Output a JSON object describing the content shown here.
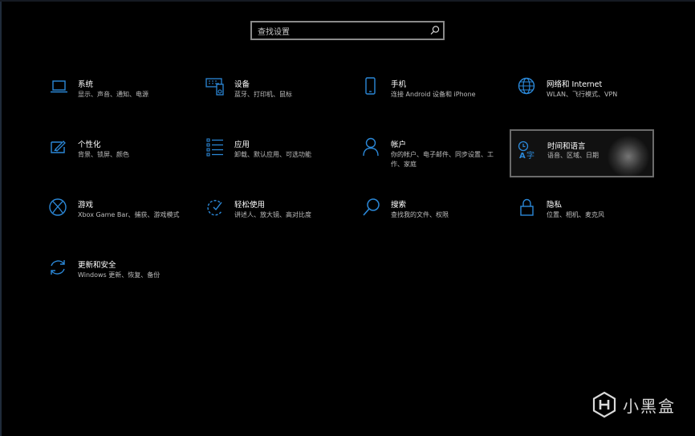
{
  "search": {
    "placeholder": "查找设置",
    "icon": "search-icon"
  },
  "accent_color": "#2b88d8",
  "tiles": [
    {
      "icon": "laptop-icon",
      "title": "系统",
      "desc": "显示、声音、通知、电源"
    },
    {
      "icon": "devices-icon",
      "title": "设备",
      "desc": "蓝牙、打印机、鼠标"
    },
    {
      "icon": "phone-icon",
      "title": "手机",
      "desc": "连接 Android 设备和 iPhone"
    },
    {
      "icon": "globe-icon",
      "title": "网络和 Internet",
      "desc": "WLAN、飞行模式、VPN"
    },
    {
      "icon": "personalization-icon",
      "title": "个性化",
      "desc": "背景、锁屏、颜色"
    },
    {
      "icon": "apps-icon",
      "title": "应用",
      "desc": "卸载、默认应用、可选功能"
    },
    {
      "icon": "person-icon",
      "title": "帐户",
      "desc": "你的帐户、电子邮件、同步设置、工作、家庭"
    },
    {
      "icon": "time-language-icon",
      "title": "时间和语言",
      "desc": "语音、区域、日期"
    },
    {
      "icon": "xbox-icon",
      "title": "游戏",
      "desc": "Xbox Game Bar、捕获、游戏模式"
    },
    {
      "icon": "ease-of-access-icon",
      "title": "轻松使用",
      "desc": "讲述人、放大镜、高对比度"
    },
    {
      "icon": "search-icon",
      "title": "搜索",
      "desc": "查找我的文件、权限"
    },
    {
      "icon": "lock-icon",
      "title": "隐私",
      "desc": "位置、相机、麦克风"
    },
    {
      "icon": "sync-icon",
      "title": "更新和安全",
      "desc": "Windows 更新、恢复、备份"
    }
  ],
  "watermark": {
    "text": "小黑盒",
    "icon": "heybox-logo-icon"
  }
}
